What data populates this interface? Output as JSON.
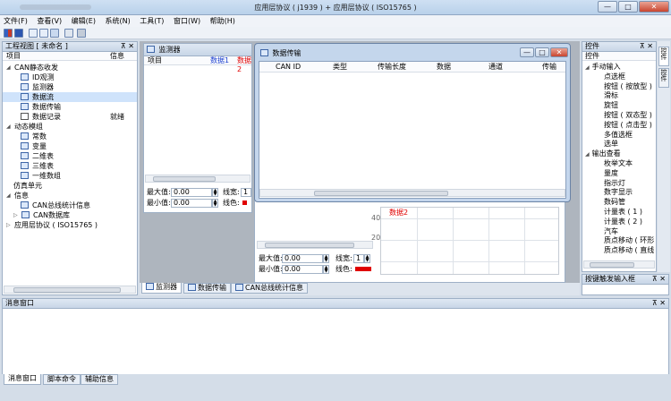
{
  "window": {
    "title": "应用层协议 ( j1939 ) + 应用层协议 ( ISO15765 )",
    "minimize_glyph": "—",
    "maximize_glyph": "□",
    "close_glyph": "✕"
  },
  "menu": [
    "文件(F)",
    "查看(V)",
    "编辑(E)",
    "系统(N)",
    "工具(T)",
    "窗口(W)",
    "帮助(H)"
  ],
  "project_view": {
    "title": "工程视图 [ 未命名 ]",
    "pin": "⊼ ✕",
    "col_item": "项目",
    "col_info": "信息",
    "tree": [
      {
        "label": "CAN静态收发",
        "indent": 0,
        "expander": "◢",
        "icon": "none"
      },
      {
        "label": "ID观测",
        "indent": 2,
        "icon": "id-icon"
      },
      {
        "label": "监测器",
        "indent": 2,
        "icon": "monitor-icon"
      },
      {
        "label": "数据流",
        "indent": 2,
        "icon": "stream-icon",
        "selected": true
      },
      {
        "label": "数据传输",
        "indent": 2,
        "icon": "transfer-icon"
      },
      {
        "label": "数据记录",
        "indent": 2,
        "icon": "checkbox-icon",
        "info": "就绪"
      },
      {
        "label": "动态模组",
        "indent": 0,
        "expander": "◢",
        "icon": "none"
      },
      {
        "label": "常数",
        "indent": 2,
        "icon": "constant-icon"
      },
      {
        "label": "变量",
        "indent": 2,
        "icon": "variable-icon"
      },
      {
        "label": "二维表",
        "indent": 2,
        "icon": "table2d-icon"
      },
      {
        "label": "三维表",
        "indent": 2,
        "icon": "table3d-icon"
      },
      {
        "label": "一维数组",
        "indent": 2,
        "icon": "array-icon"
      },
      {
        "label": "仿真单元",
        "indent": 1,
        "icon": "none"
      },
      {
        "label": "信息",
        "indent": 0,
        "expander": "◢",
        "icon": "none"
      },
      {
        "label": "CAN总线统计信息",
        "indent": 2,
        "icon": "stats-icon"
      },
      {
        "label": "CAN数据库",
        "indent": 1,
        "expander": "▷",
        "icon": "database-icon"
      },
      {
        "label": "应用层协议 ( ISO15765 )",
        "indent": 0,
        "expander": "▷",
        "icon": "none"
      }
    ]
  },
  "monitor": {
    "title": "监测器",
    "col_item": "项目",
    "col_data1": "数据1",
    "col_data2": "数据2",
    "max_label": "最大值:",
    "max_value": "0.00",
    "min_label": "最小值:",
    "min_value": "0.00",
    "width_label": "线宽:",
    "width_value": "1",
    "color_label": "线色:"
  },
  "monitor2": {
    "max_label": "最大值:",
    "max_value": "0.00",
    "min_label": "最小值:",
    "min_value": "0.00",
    "width_label": "线宽:",
    "width_value": "1",
    "color_label": "线色:",
    "y_tick_40": "40",
    "y_tick_20": "20",
    "legend_red": "数据2"
  },
  "data_transfer": {
    "title": "数据传输",
    "columns": [
      "CAN ID",
      "类型",
      "传输长度",
      "数据",
      "通道",
      "传输"
    ]
  },
  "center_tabs": [
    "监测器",
    "数据传输",
    "CAN总线统计信息"
  ],
  "controls": {
    "title": "控件",
    "pin": "⊼ ✕",
    "col": "控件",
    "side_tab_1": "控件",
    "side_tab_2": "控件",
    "tree": [
      {
        "label": "手动输入",
        "group": true
      },
      {
        "label": "点选框"
      },
      {
        "label": "按钮 ( 按放型 )"
      },
      {
        "label": "滑标"
      },
      {
        "label": "旋钮"
      },
      {
        "label": "按钮 ( 双态型 )"
      },
      {
        "label": "按钮 ( 点击型 )"
      },
      {
        "label": "多值选框"
      },
      {
        "label": "选单"
      },
      {
        "label": "输出查看",
        "group": true
      },
      {
        "label": "枚举文本"
      },
      {
        "label": "量度"
      },
      {
        "label": "指示灯"
      },
      {
        "label": "数字显示"
      },
      {
        "label": "数码管"
      },
      {
        "label": "计量表 ( 1 )"
      },
      {
        "label": "计量表 ( 2 )"
      },
      {
        "label": "汽车"
      },
      {
        "label": "质点移动 ( 环形"
      },
      {
        "label": "质点移动 ( 直线"
      }
    ]
  },
  "key_trigger": {
    "title": "按键触发输入框",
    "pin": "⊼ ✕"
  },
  "message": {
    "title": "消息窗口",
    "pin": "⊼ ✕",
    "tabs": [
      "消息窗口",
      "脚本命令",
      "辅助信息"
    ]
  },
  "colors": {
    "accent": "#3e66a7",
    "line_red": "#e00000",
    "selection": "#cfe3fb"
  }
}
